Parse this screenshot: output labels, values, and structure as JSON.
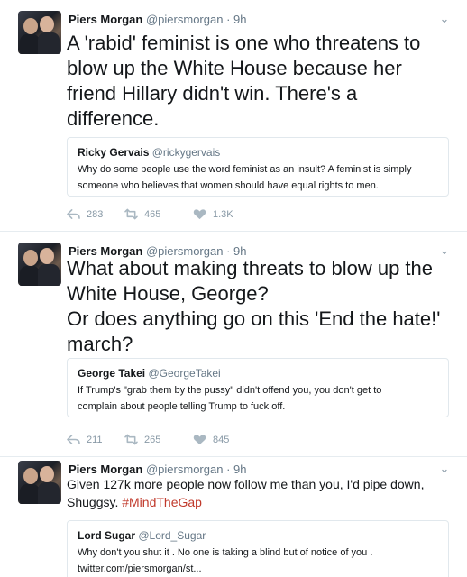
{
  "tweets": [
    {
      "name": "Piers Morgan",
      "handle": "@piersmorgan",
      "dot": "·",
      "time": "9h",
      "lines": [
        "A 'rabid' feminist is one who threatens to",
        "blow up the White House because her",
        "friend Hillary didn't win. There's a",
        "difference."
      ],
      "quote": {
        "name": "Ricky Gervais",
        "handle": "@rickygervais",
        "lines": [
          "Why do some people use the word feminist as an insult? A feminist is simply",
          "someone who believes that women should have equal rights to men."
        ]
      },
      "replies": "283",
      "retweets": "465",
      "likes": "1.3K"
    },
    {
      "name": "Piers Morgan",
      "handle": "@piersmorgan",
      "dot": "·",
      "time": "9h",
      "lines": [
        "What about making threats to blow up the",
        "White House, George?",
        "Or does anything go on this 'End the hate!'",
        "march?"
      ],
      "quote": {
        "name": "George Takei",
        "handle": "@GeorgeTakei",
        "lines": [
          "If Trump's \"grab them by the pussy\" didn't offend you, you don't get to",
          "complain about people telling Trump to fuck off."
        ]
      },
      "replies": "211",
      "retweets": "265",
      "likes": "845"
    },
    {
      "name": "Piers Morgan",
      "handle": "@piersmorgan",
      "dot": "·",
      "time": "9h",
      "line1": "Given 127k more people now follow me than you, I'd pipe down,",
      "line2_text": "Shuggsy.",
      "hashtag": "#MindTheGap",
      "quote": {
        "name": "Lord Sugar",
        "handle": "@Lord_Sugar",
        "lines": [
          "Why don't you shut it . No one  is taking a blind but of notice of you .",
          "twitter.com/piersmorgan/st..."
        ]
      }
    }
  ],
  "icons": {
    "reply": "reply-icon",
    "retweet": "retweet-icon",
    "like": "heart-icon",
    "menu": "chevron-down-icon"
  },
  "colors": {
    "hashtag": "#c0392b",
    "muted": "#657786",
    "border": "#e1e8ed"
  }
}
